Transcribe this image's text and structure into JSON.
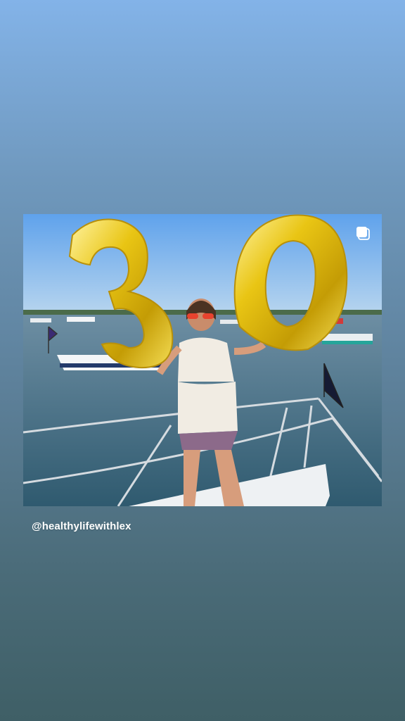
{
  "story": {
    "background_top": "#83b3e8",
    "background_bottom": "#3f5f66"
  },
  "post": {
    "balloon_digits": [
      "3",
      "0"
    ],
    "balloon_color": "#e8c21a",
    "multiple_images_icon": "multiple-images-icon"
  },
  "mention": {
    "username": "@healthylifewithlex"
  }
}
